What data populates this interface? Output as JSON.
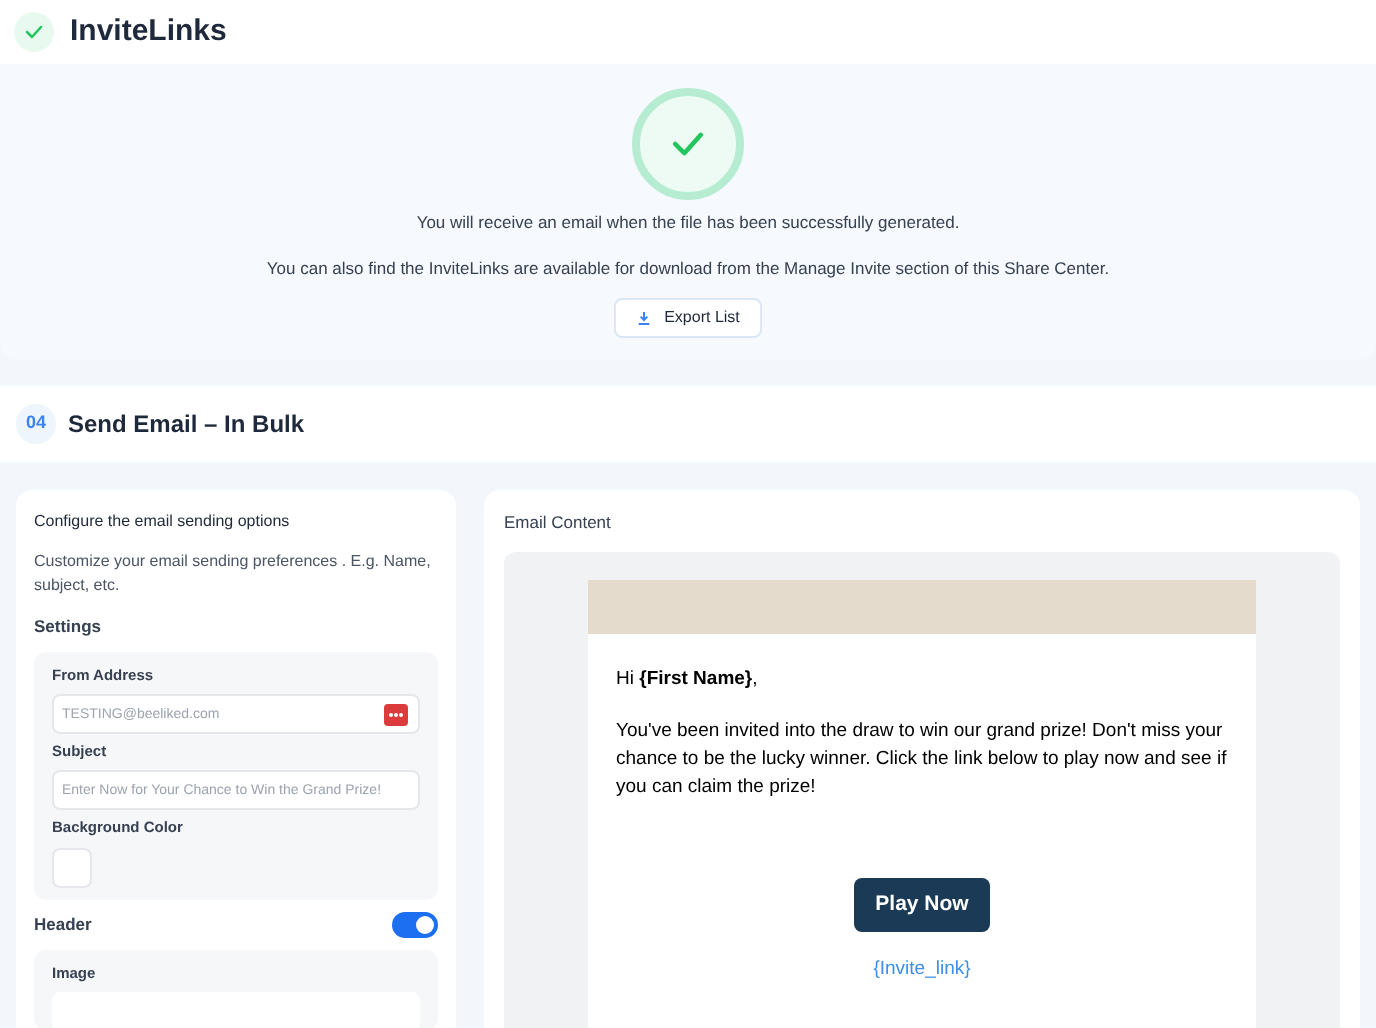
{
  "header": {
    "title": "InviteLinks"
  },
  "status": {
    "messages": [
      "You will receive an email when the file has been successfully generated.",
      "You can also find the InviteLinks are available for download from the Manage Invite section of this Share Center."
    ],
    "button": "Export List"
  },
  "section": {
    "number": "04",
    "title": "Send Email – In Bulk"
  },
  "settings_panel": {
    "title": "Configure the email sending options",
    "description": "Customize your email sending preferences . E.g. Name, subject, etc.",
    "settings_label": "Settings",
    "fields": [
      {
        "kind": "text",
        "label": "From Address",
        "placeholder": "TESTING@beeliked.com",
        "badge": true
      },
      {
        "kind": "text",
        "label": "Subject",
        "placeholder": "Enter Now for Your Chance to Win the Grand Prize!",
        "badge": false
      },
      {
        "kind": "color",
        "label": "Background Color",
        "color": "#ffffff"
      }
    ],
    "header_toggle": {
      "label": "Header",
      "on": true
    },
    "header_fields": [
      {
        "label": "Image"
      }
    ]
  },
  "email_preview": {
    "title": "Email Content",
    "greeting": "Hi **{First Name}**,",
    "body": "You've been invited into the draw to win our grand prize! Don't miss your chance to be the lucky winner. Click the link below to play now and see if you can claim the prize!",
    "button": "Play Now",
    "link": "{Invite_link}"
  }
}
